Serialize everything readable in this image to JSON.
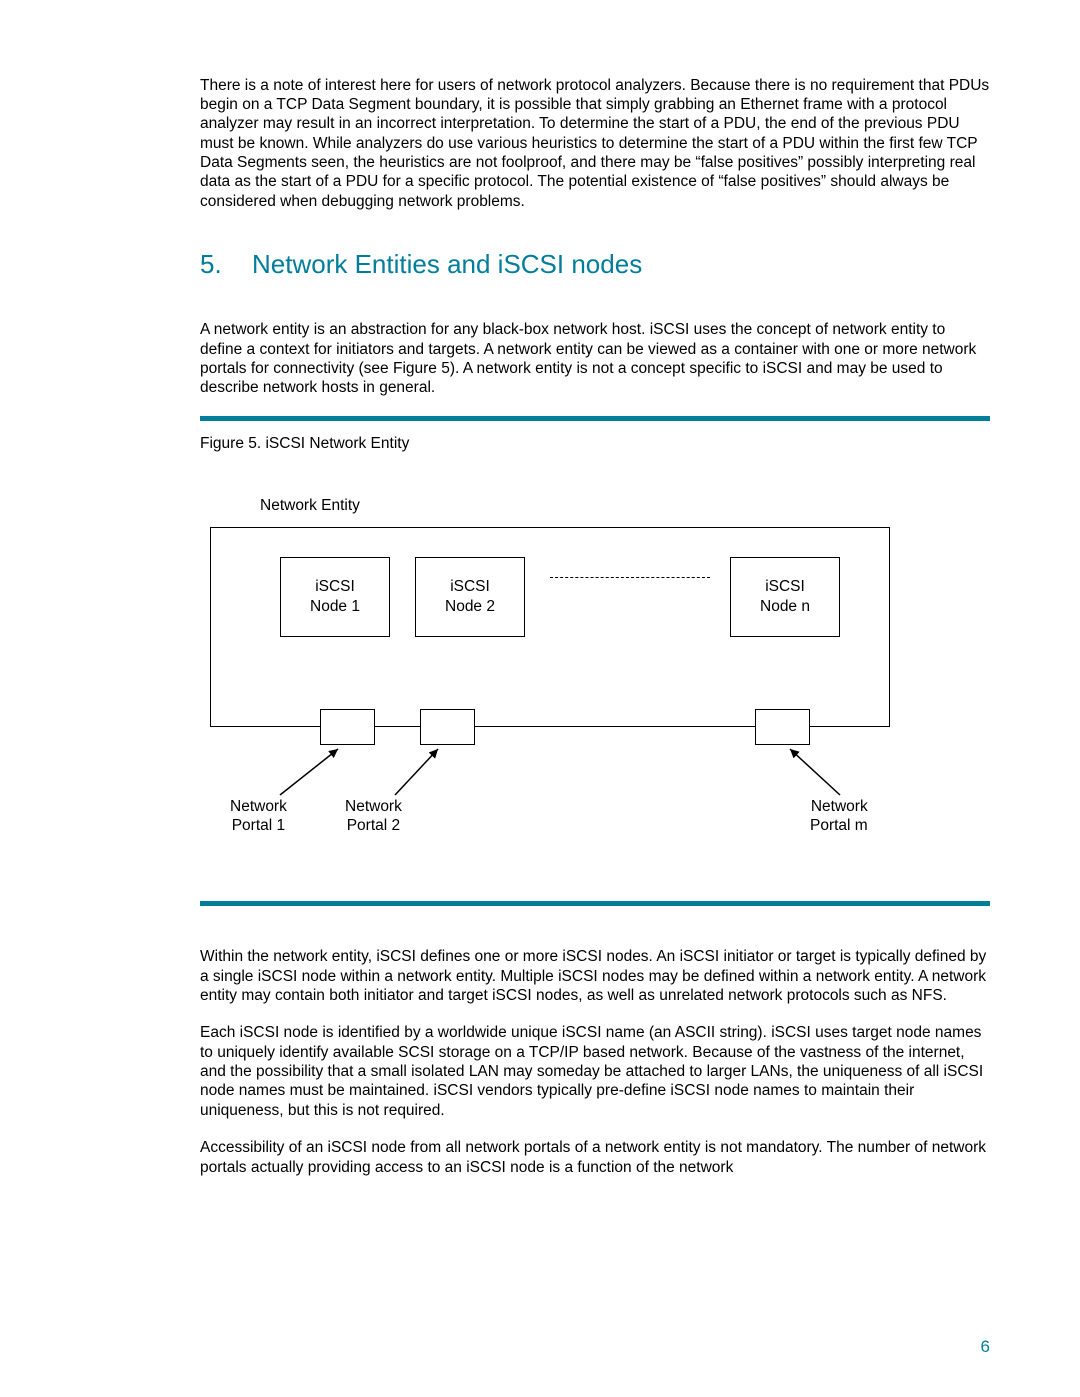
{
  "para_intro": "There is a note of interest here for users of network protocol analyzers.  Because there is no requirement that PDUs begin on a TCP Data Segment boundary, it is possible that simply grabbing an Ethernet frame with a protocol analyzer may result in an incorrect interpretation.  To determine the start of a PDU, the end of the previous PDU must be known.  While analyzers do use various heuristics to determine the start of a PDU within the first few TCP Data Segments seen, the heuristics are not foolproof, and there may be “false positives” possibly interpreting real data as the start of a PDU for a specific protocol.  The potential existence of “false positives” should always be considered when debugging network problems.",
  "heading": {
    "num": "5.",
    "title": "Network Entities and iSCSI nodes"
  },
  "para_entity": "A network entity is an abstraction for any black-box network host.  iSCSI uses the concept of network entity to define a context for initiators and targets.  A network entity can be viewed as a container with one or more network portals for connectivity (see Figure 5).  A network entity is not a concept specific to iSCSI and may be used to describe network hosts in general.",
  "figure": {
    "caption": "Figure 5. iSCSI Network Entity",
    "entity_title": "Network Entity",
    "nodes": {
      "n1_l1": "iSCSI",
      "n1_l2": "Node 1",
      "n2_l1": "iSCSI",
      "n2_l2": "Node 2",
      "nn_l1": "iSCSI",
      "nn_l2": "Node n"
    },
    "portals": {
      "p1_l1": "Network",
      "p1_l2": "Portal 1",
      "p2_l1": "Network",
      "p2_l2": "Portal 2",
      "pm_l1": "Network",
      "pm_l2": "Portal m"
    }
  },
  "para_within": "Within the network entity, iSCSI defines one or more iSCSI nodes.  An iSCSI initiator or target is typically defined by a single iSCSI node within a network entity.  Multiple iSCSI nodes may be defined within a network entity.  A network entity may contain both initiator and target iSCSI nodes, as well as unrelated network protocols such as NFS.",
  "para_each": "Each iSCSI node is identified by a worldwide unique iSCSI name (an ASCII string).  iSCSI uses target node names to uniquely identify available SCSI storage on a TCP/IP based network.  Because of the vastness of the internet, and the possibility that a small isolated LAN may someday be attached to larger LANs, the uniqueness of all iSCSI node names must be maintained.  iSCSI vendors typically pre-define iSCSI node names to maintain their uniqueness, but this is not required.",
  "para_access": "Accessibility of an iSCSI node from all network portals of a network entity is not mandatory.  The number of network portals actually providing access to an iSCSI node is a function of the network",
  "page_number": "6"
}
